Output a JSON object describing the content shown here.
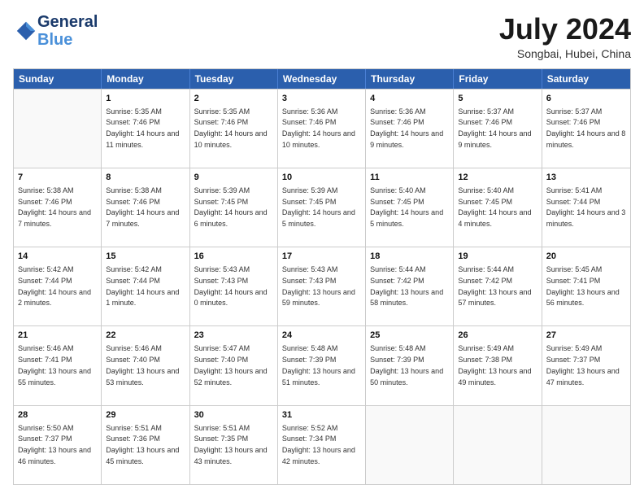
{
  "header": {
    "logo_line1": "General",
    "logo_line2": "Blue",
    "month_title": "July 2024",
    "location": "Songbai, Hubei, China"
  },
  "weekdays": [
    "Sunday",
    "Monday",
    "Tuesday",
    "Wednesday",
    "Thursday",
    "Friday",
    "Saturday"
  ],
  "weeks": [
    [
      {
        "day": "",
        "empty": true
      },
      {
        "day": "1",
        "sunrise": "Sunrise: 5:35 AM",
        "sunset": "Sunset: 7:46 PM",
        "daylight": "Daylight: 14 hours and 11 minutes."
      },
      {
        "day": "2",
        "sunrise": "Sunrise: 5:35 AM",
        "sunset": "Sunset: 7:46 PM",
        "daylight": "Daylight: 14 hours and 10 minutes."
      },
      {
        "day": "3",
        "sunrise": "Sunrise: 5:36 AM",
        "sunset": "Sunset: 7:46 PM",
        "daylight": "Daylight: 14 hours and 10 minutes."
      },
      {
        "day": "4",
        "sunrise": "Sunrise: 5:36 AM",
        "sunset": "Sunset: 7:46 PM",
        "daylight": "Daylight: 14 hours and 9 minutes."
      },
      {
        "day": "5",
        "sunrise": "Sunrise: 5:37 AM",
        "sunset": "Sunset: 7:46 PM",
        "daylight": "Daylight: 14 hours and 9 minutes."
      },
      {
        "day": "6",
        "sunrise": "Sunrise: 5:37 AM",
        "sunset": "Sunset: 7:46 PM",
        "daylight": "Daylight: 14 hours and 8 minutes."
      }
    ],
    [
      {
        "day": "7",
        "sunrise": "Sunrise: 5:38 AM",
        "sunset": "Sunset: 7:46 PM",
        "daylight": "Daylight: 14 hours and 7 minutes."
      },
      {
        "day": "8",
        "sunrise": "Sunrise: 5:38 AM",
        "sunset": "Sunset: 7:46 PM",
        "daylight": "Daylight: 14 hours and 7 minutes."
      },
      {
        "day": "9",
        "sunrise": "Sunrise: 5:39 AM",
        "sunset": "Sunset: 7:45 PM",
        "daylight": "Daylight: 14 hours and 6 minutes."
      },
      {
        "day": "10",
        "sunrise": "Sunrise: 5:39 AM",
        "sunset": "Sunset: 7:45 PM",
        "daylight": "Daylight: 14 hours and 5 minutes."
      },
      {
        "day": "11",
        "sunrise": "Sunrise: 5:40 AM",
        "sunset": "Sunset: 7:45 PM",
        "daylight": "Daylight: 14 hours and 5 minutes."
      },
      {
        "day": "12",
        "sunrise": "Sunrise: 5:40 AM",
        "sunset": "Sunset: 7:45 PM",
        "daylight": "Daylight: 14 hours and 4 minutes."
      },
      {
        "day": "13",
        "sunrise": "Sunrise: 5:41 AM",
        "sunset": "Sunset: 7:44 PM",
        "daylight": "Daylight: 14 hours and 3 minutes."
      }
    ],
    [
      {
        "day": "14",
        "sunrise": "Sunrise: 5:42 AM",
        "sunset": "Sunset: 7:44 PM",
        "daylight": "Daylight: 14 hours and 2 minutes."
      },
      {
        "day": "15",
        "sunrise": "Sunrise: 5:42 AM",
        "sunset": "Sunset: 7:44 PM",
        "daylight": "Daylight: 14 hours and 1 minute."
      },
      {
        "day": "16",
        "sunrise": "Sunrise: 5:43 AM",
        "sunset": "Sunset: 7:43 PM",
        "daylight": "Daylight: 14 hours and 0 minutes."
      },
      {
        "day": "17",
        "sunrise": "Sunrise: 5:43 AM",
        "sunset": "Sunset: 7:43 PM",
        "daylight": "Daylight: 13 hours and 59 minutes."
      },
      {
        "day": "18",
        "sunrise": "Sunrise: 5:44 AM",
        "sunset": "Sunset: 7:42 PM",
        "daylight": "Daylight: 13 hours and 58 minutes."
      },
      {
        "day": "19",
        "sunrise": "Sunrise: 5:44 AM",
        "sunset": "Sunset: 7:42 PM",
        "daylight": "Daylight: 13 hours and 57 minutes."
      },
      {
        "day": "20",
        "sunrise": "Sunrise: 5:45 AM",
        "sunset": "Sunset: 7:41 PM",
        "daylight": "Daylight: 13 hours and 56 minutes."
      }
    ],
    [
      {
        "day": "21",
        "sunrise": "Sunrise: 5:46 AM",
        "sunset": "Sunset: 7:41 PM",
        "daylight": "Daylight: 13 hours and 55 minutes."
      },
      {
        "day": "22",
        "sunrise": "Sunrise: 5:46 AM",
        "sunset": "Sunset: 7:40 PM",
        "daylight": "Daylight: 13 hours and 53 minutes."
      },
      {
        "day": "23",
        "sunrise": "Sunrise: 5:47 AM",
        "sunset": "Sunset: 7:40 PM",
        "daylight": "Daylight: 13 hours and 52 minutes."
      },
      {
        "day": "24",
        "sunrise": "Sunrise: 5:48 AM",
        "sunset": "Sunset: 7:39 PM",
        "daylight": "Daylight: 13 hours and 51 minutes."
      },
      {
        "day": "25",
        "sunrise": "Sunrise: 5:48 AM",
        "sunset": "Sunset: 7:39 PM",
        "daylight": "Daylight: 13 hours and 50 minutes."
      },
      {
        "day": "26",
        "sunrise": "Sunrise: 5:49 AM",
        "sunset": "Sunset: 7:38 PM",
        "daylight": "Daylight: 13 hours and 49 minutes."
      },
      {
        "day": "27",
        "sunrise": "Sunrise: 5:49 AM",
        "sunset": "Sunset: 7:37 PM",
        "daylight": "Daylight: 13 hours and 47 minutes."
      }
    ],
    [
      {
        "day": "28",
        "sunrise": "Sunrise: 5:50 AM",
        "sunset": "Sunset: 7:37 PM",
        "daylight": "Daylight: 13 hours and 46 minutes."
      },
      {
        "day": "29",
        "sunrise": "Sunrise: 5:51 AM",
        "sunset": "Sunset: 7:36 PM",
        "daylight": "Daylight: 13 hours and 45 minutes."
      },
      {
        "day": "30",
        "sunrise": "Sunrise: 5:51 AM",
        "sunset": "Sunset: 7:35 PM",
        "daylight": "Daylight: 13 hours and 43 minutes."
      },
      {
        "day": "31",
        "sunrise": "Sunrise: 5:52 AM",
        "sunset": "Sunset: 7:34 PM",
        "daylight": "Daylight: 13 hours and 42 minutes."
      },
      {
        "day": "",
        "empty": true
      },
      {
        "day": "",
        "empty": true
      },
      {
        "day": "",
        "empty": true
      }
    ]
  ]
}
